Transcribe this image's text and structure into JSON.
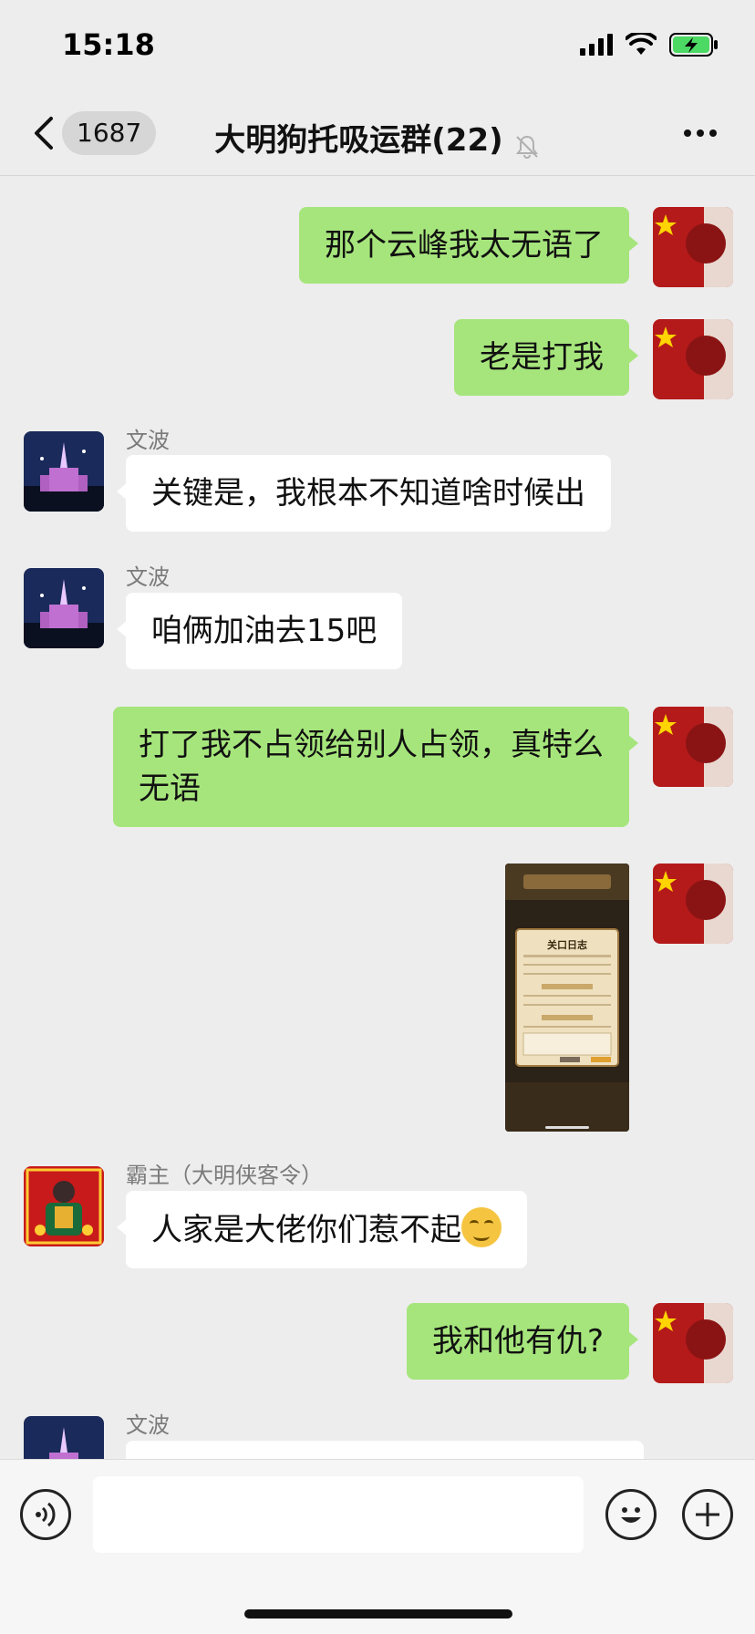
{
  "status_bar": {
    "time": "15:18"
  },
  "header": {
    "back_count": "1687",
    "title": "大明狗托吸运群(22)",
    "icons": [
      "back-chevron-icon",
      "mute-bell-icon",
      "more-icon"
    ]
  },
  "messages": [
    {
      "side": "me",
      "text": "那个云峰我太无语了"
    },
    {
      "side": "me",
      "text": "老是打我"
    },
    {
      "side": "other",
      "sender": "文波",
      "text": "关键是，我根本不知道啥时候出"
    },
    {
      "side": "other",
      "sender": "文波",
      "text": "咱俩加油去15吧"
    },
    {
      "side": "me",
      "text": "打了我不占领给别人占领，真特么无语"
    },
    {
      "side": "me",
      "type": "image",
      "image_title": "关口日志"
    },
    {
      "side": "other",
      "sender": "霸主（大明侠客令）",
      "text": "人家是大佬你们惹不起",
      "emoji": "grinning-smirk-emoji"
    },
    {
      "side": "me",
      "text": "我和他有仇?"
    },
    {
      "side": "other",
      "sender": "文波",
      "text": ""
    }
  ],
  "input_bar": {
    "value": "",
    "icons": [
      "voice-icon",
      "emoji-icon",
      "plus-icon"
    ]
  },
  "colors": {
    "me_bubble": "#a6e57c",
    "other_bubble": "#ffffff",
    "background": "#ededed"
  }
}
